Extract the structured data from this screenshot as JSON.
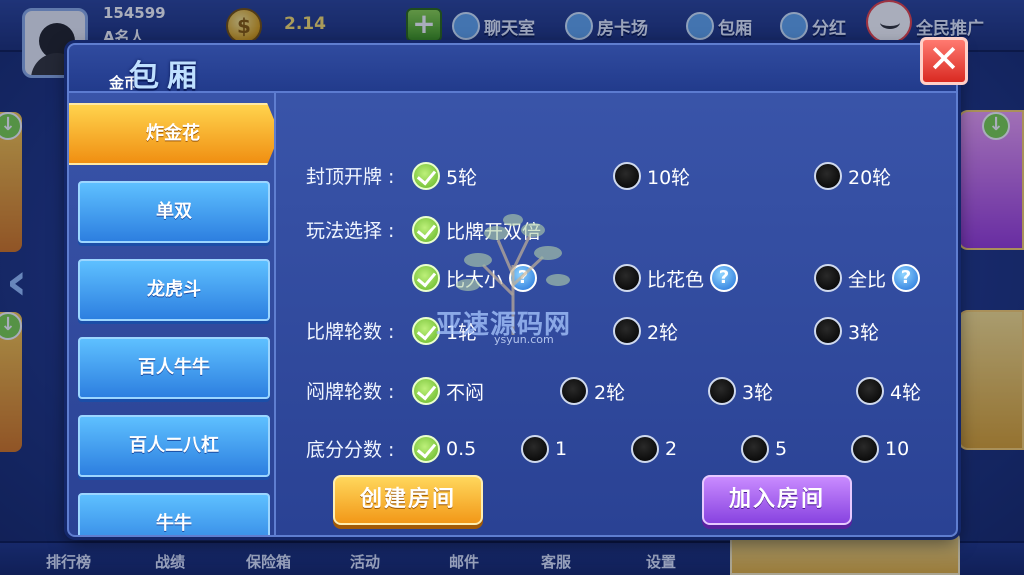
{
  "user": {
    "id": "154599",
    "name": "A名人",
    "coins": "2.14"
  },
  "topnav": [
    {
      "label": "聊天室",
      "icon": "chat-room-icon"
    },
    {
      "label": "房卡场",
      "icon": "room-card-icon"
    },
    {
      "label": "包厢",
      "icon": "private-room-icon"
    },
    {
      "label": "分红",
      "icon": "dividend-icon"
    },
    {
      "label": "全民推广",
      "icon": "promote-cat-icon"
    }
  ],
  "bottom_nav": [
    "排行榜",
    "战绩",
    "保险箱",
    "活动",
    "邮件",
    "客服",
    "设置"
  ],
  "dialog": {
    "title": "包厢",
    "subtitle": "金币",
    "close": "✕",
    "tabs": [
      "炸金花",
      "单双",
      "龙虎斗",
      "百人牛牛",
      "百人二八杠",
      "牛牛"
    ],
    "active_tab": 0,
    "rows": [
      {
        "label": "封顶开牌 :",
        "options": [
          {
            "text": "5轮",
            "checked": true
          },
          {
            "text": "10轮",
            "checked": false
          },
          {
            "text": "20轮",
            "checked": false
          }
        ]
      },
      {
        "label": "玩法选择 :",
        "options": [
          {
            "text": "比牌开双倍",
            "checked": true
          }
        ]
      },
      {
        "label": "",
        "options": [
          {
            "text": "比大小",
            "checked": true,
            "help": "?"
          },
          {
            "text": "比花色",
            "checked": false,
            "help": "?"
          },
          {
            "text": "全比",
            "checked": false,
            "help": "?"
          }
        ]
      },
      {
        "label": "比牌轮数 :",
        "options": [
          {
            "text": "1轮",
            "checked": true
          },
          {
            "text": "2轮",
            "checked": false
          },
          {
            "text": "3轮",
            "checked": false
          }
        ]
      },
      {
        "label": "闷牌轮数 :",
        "options": [
          {
            "text": "不闷",
            "checked": true
          },
          {
            "text": "2轮",
            "checked": false
          },
          {
            "text": "3轮",
            "checked": false
          },
          {
            "text": "4轮",
            "checked": false
          }
        ]
      },
      {
        "label": "底分分数 :",
        "options": [
          {
            "text": "0.5",
            "checked": true
          },
          {
            "text": "1",
            "checked": false
          },
          {
            "text": "2",
            "checked": false
          },
          {
            "text": "5",
            "checked": false
          },
          {
            "text": "10",
            "checked": false
          }
        ]
      }
    ],
    "create_button": "创建房间",
    "join_button": "加入房间"
  },
  "watermark": {
    "text": "亚速源码网",
    "url": "ysyun.com"
  },
  "colors": {
    "accent_orange": "#f29818",
    "accent_purple": "#8843e0",
    "tab_blue": "#2d7fe0",
    "checked_green": "#62b525"
  }
}
